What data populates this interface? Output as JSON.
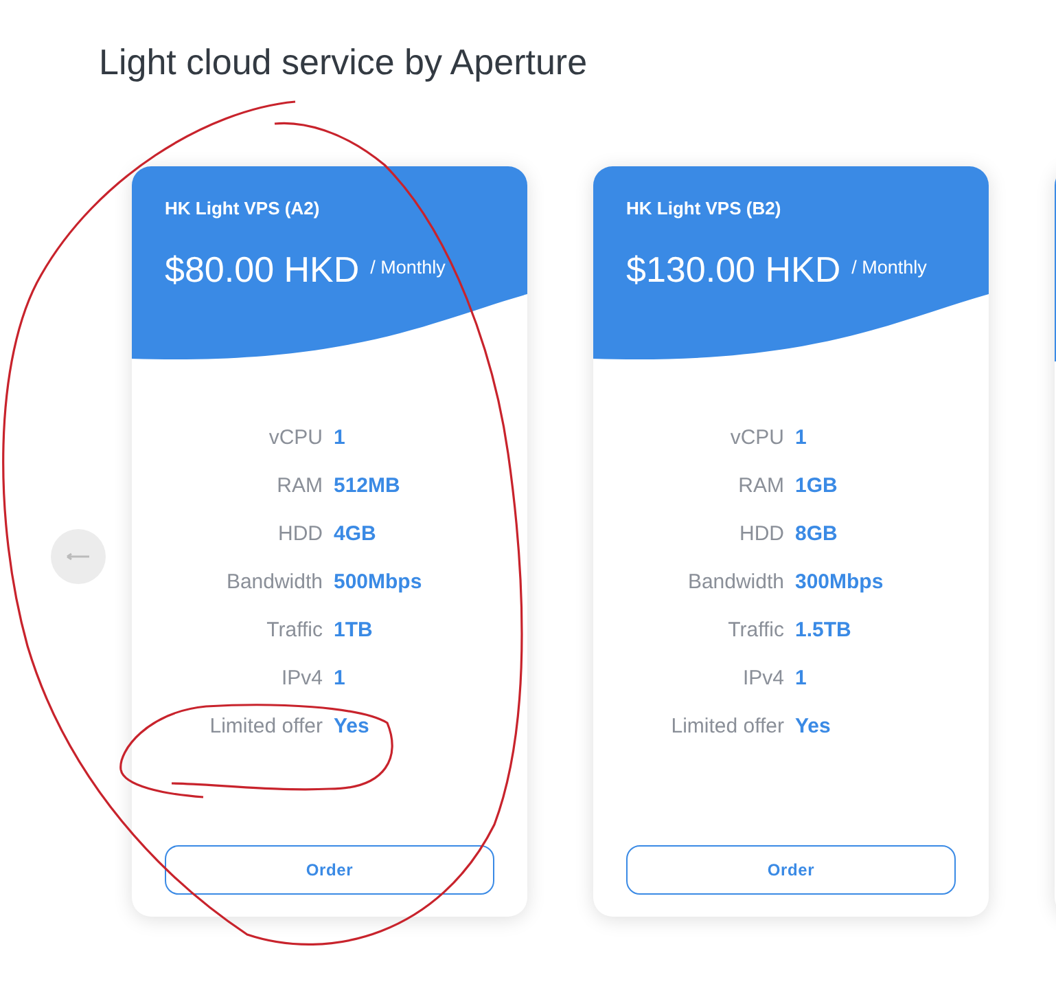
{
  "heading": "Light cloud service by Aperture",
  "plans": [
    {
      "name": "HK Light VPS (A2)",
      "price": "$80.00 HKD",
      "period": "/ Monthly",
      "specs": [
        {
          "label": "vCPU",
          "value": "1"
        },
        {
          "label": "RAM",
          "value": "512MB"
        },
        {
          "label": "HDD",
          "value": "4GB"
        },
        {
          "label": "Bandwidth",
          "value": "500Mbps"
        },
        {
          "label": "Traffic",
          "value": "1TB"
        },
        {
          "label": "IPv4",
          "value": "1"
        },
        {
          "label": "Limited offer",
          "value": "Yes"
        }
      ],
      "button": "Order"
    },
    {
      "name": "HK Light VPS (B2)",
      "price": "$130.00 HKD",
      "period": "/ Monthly",
      "specs": [
        {
          "label": "vCPU",
          "value": "1"
        },
        {
          "label": "RAM",
          "value": "1GB"
        },
        {
          "label": "HDD",
          "value": "8GB"
        },
        {
          "label": "Bandwidth",
          "value": "300Mbps"
        },
        {
          "label": "Traffic",
          "value": "1.5TB"
        },
        {
          "label": "IPv4",
          "value": "1"
        },
        {
          "label": "Limited offer",
          "value": "Yes"
        }
      ],
      "button": "Order"
    }
  ]
}
